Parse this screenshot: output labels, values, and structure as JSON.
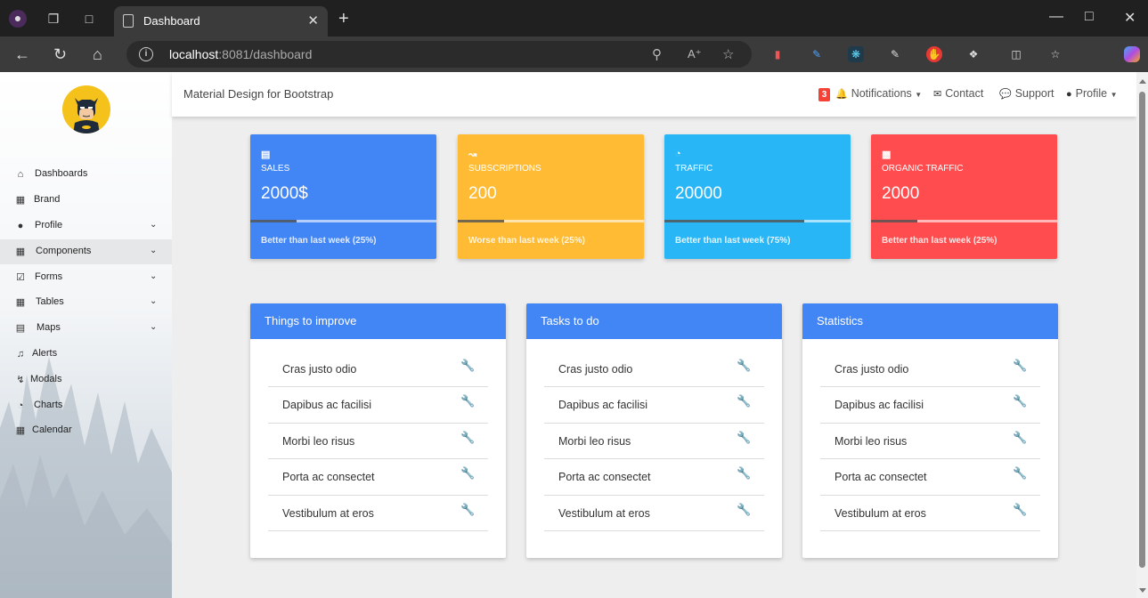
{
  "browser": {
    "tab_title": "Dashboard",
    "url_host": "localhost",
    "url_rest": ":8081/dashboard"
  },
  "sidebar": {
    "items": [
      {
        "label": "Dashboards",
        "icon": "home-icon"
      },
      {
        "label": "Brand",
        "icon": "grid-icon"
      },
      {
        "label": "Profile",
        "icon": "user-icon"
      },
      {
        "label": "Components",
        "icon": "apps-icon"
      },
      {
        "label": "Forms",
        "icon": "checkbox-icon"
      },
      {
        "label": "Tables",
        "icon": "table-icon"
      },
      {
        "label": "Maps",
        "icon": "map-icon"
      },
      {
        "label": "Alerts",
        "icon": "bell-icon"
      },
      {
        "label": "Modals",
        "icon": "bolt-icon"
      },
      {
        "label": "Charts",
        "icon": "pie-chart-icon"
      },
      {
        "label": "Calendar",
        "icon": "calendar-icon"
      }
    ]
  },
  "topnav": {
    "brand": "Material Design for Bootstrap",
    "notifications_count": "3",
    "notifications": "Notifications",
    "contact": "Contact",
    "support": "Support",
    "profile": "Profile"
  },
  "cards": [
    {
      "title": "SALES",
      "value": "2000$",
      "footer": "Better than last week (25%)",
      "progress": 0.25,
      "color": "#4285f4",
      "icon": "money-icon"
    },
    {
      "title": "SUBSCRIPTIONS",
      "value": "200",
      "footer": "Worse than last week (25%)",
      "progress": 0.25,
      "color": "#ffbb33",
      "icon": "line-chart-icon"
    },
    {
      "title": "TRAFFIC",
      "value": "20000",
      "footer": "Better than last week (75%)",
      "progress": 0.75,
      "color": "#29b6f6",
      "icon": "pie-chart-icon"
    },
    {
      "title": "ORGANIC TRAFFIC",
      "value": "2000",
      "footer": "Better than last week (25%)",
      "progress": 0.25,
      "color": "#ff4d4f",
      "icon": "bar-chart-icon"
    }
  ],
  "panels": [
    {
      "title": "Things to improve",
      "items": [
        "Cras justo odio",
        "Dapibus ac facilisi",
        "Morbi leo risus",
        "Porta ac consectet",
        "Vestibulum at eros"
      ]
    },
    {
      "title": "Tasks to do",
      "items": [
        "Cras justo odio",
        "Dapibus ac facilisi",
        "Morbi leo risus",
        "Porta ac consectet",
        "Vestibulum at eros"
      ]
    },
    {
      "title": "Statistics",
      "items": [
        "Cras justo odio",
        "Dapibus ac facilisi",
        "Morbi leo risus",
        "Porta ac consectet",
        "Vestibulum at eros"
      ]
    }
  ]
}
